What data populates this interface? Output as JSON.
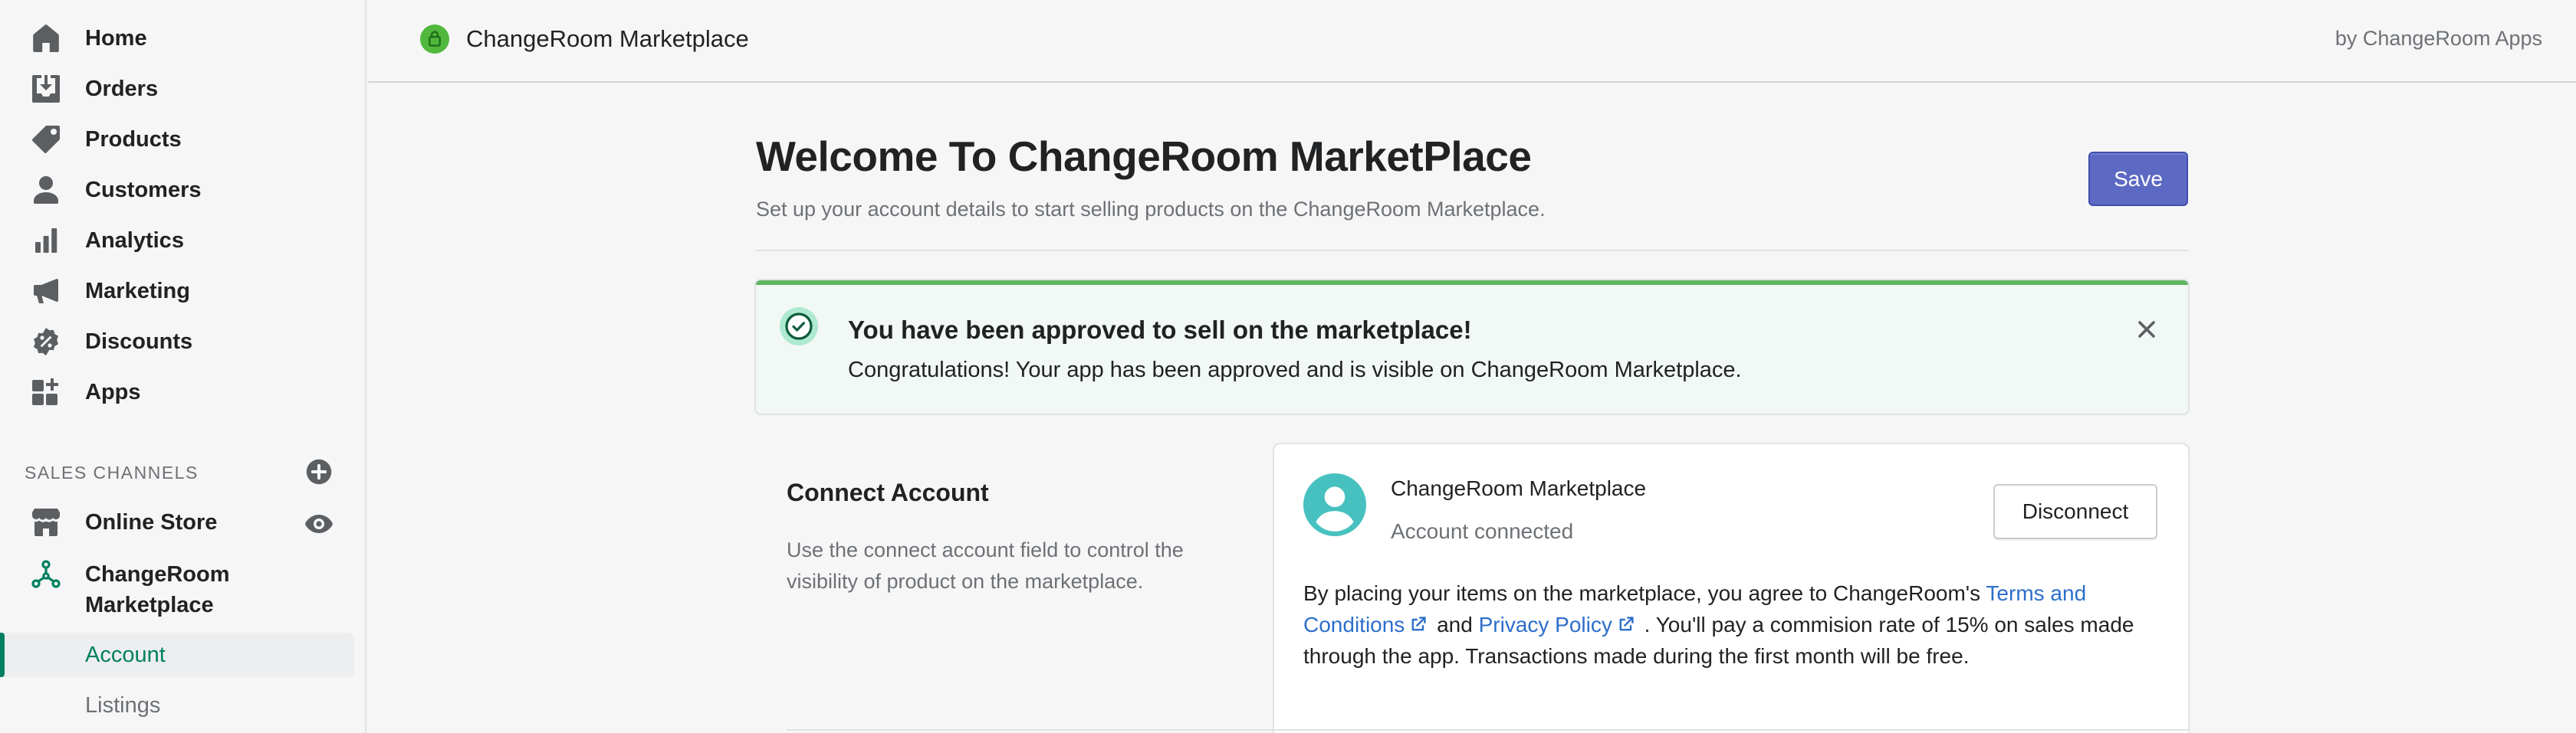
{
  "sidebar": {
    "items": [
      {
        "label": "Home",
        "icon": "home-icon"
      },
      {
        "label": "Orders",
        "icon": "orders-icon"
      },
      {
        "label": "Products",
        "icon": "tag-icon"
      },
      {
        "label": "Customers",
        "icon": "person-icon"
      },
      {
        "label": "Analytics",
        "icon": "bar-chart-icon"
      },
      {
        "label": "Marketing",
        "icon": "megaphone-icon"
      },
      {
        "label": "Discounts",
        "icon": "discount-icon"
      },
      {
        "label": "Apps",
        "icon": "apps-icon"
      }
    ],
    "sales_channels_heading": "SALES CHANNELS",
    "channels": [
      {
        "label": "Online Store",
        "icon": "store-icon"
      },
      {
        "label": "ChangeRoom Marketplace",
        "line1": "ChangeRoom",
        "line2": "Marketplace",
        "icon": "network-icon"
      }
    ],
    "sub_items": [
      {
        "label": "Account",
        "active": true
      },
      {
        "label": "Listings",
        "active": false
      }
    ]
  },
  "topbar": {
    "app_title": "ChangeRoom Marketplace",
    "byline": "by ChangeRoom Apps"
  },
  "page": {
    "title": "Welcome To ChangeRoom MarketPlace",
    "subtitle": "Set up your account details to start selling products on the ChangeRoom Marketplace.",
    "save_label": "Save"
  },
  "banner": {
    "title": "You have been approved to sell on the marketplace!",
    "body": "Congratulations! Your app has been approved and is visible on ChangeRoom Marketplace."
  },
  "connect": {
    "section_title": "Connect Account",
    "section_desc": "Use the connect account field to control the visibility of product on the marketplace.",
    "account_name": "ChangeRoom Marketplace",
    "account_status": "Account connected",
    "disconnect_label": "Disconnect",
    "terms_prefix": "By placing your items on the marketplace, you agree to ChangeRoom's ",
    "terms_link": "Terms and Conditions",
    "terms_and": " and ",
    "privacy_link": "Privacy Policy",
    "terms_suffix": " . You'll pay a commision rate of 15% on sales made through the app. Transactions made during the first month will be free."
  },
  "colors": {
    "accent": "#5c6ac4",
    "success": "#5fb55f",
    "link": "#2c6ecb",
    "active_nav": "#008060"
  }
}
